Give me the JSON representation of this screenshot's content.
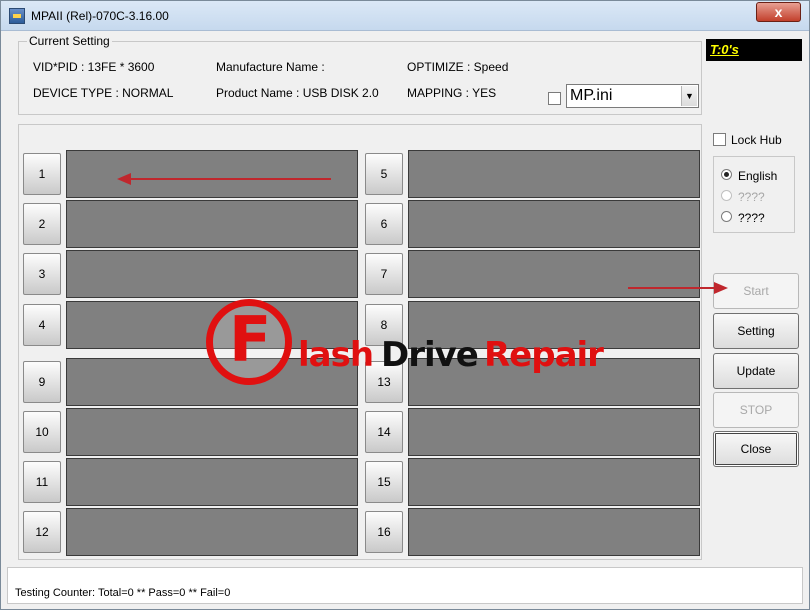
{
  "window": {
    "title": "MPAII (Rel)-070C-3.16.00",
    "close_glyph": "x"
  },
  "current_setting": {
    "legend": "Current Setting",
    "vid_pid": "VID*PID : 13FE * 3600",
    "manufacture_name": "Manufacture Name :",
    "optimize": "OPTIMIZE : Speed",
    "device_type": "DEVICE TYPE : NORMAL",
    "product_name": "Product Name : USB DISK 2.0",
    "mapping": "MAPPING : YES",
    "ini_file": "MP.ini"
  },
  "timer": "T:0's",
  "ports": {
    "left": [
      {
        "label": "1"
      },
      {
        "label": "2"
      },
      {
        "label": "3"
      },
      {
        "label": "4"
      },
      {
        "label": "9"
      },
      {
        "label": "10"
      },
      {
        "label": "11"
      },
      {
        "label": "12"
      }
    ],
    "right": [
      {
        "label": "5"
      },
      {
        "label": "6"
      },
      {
        "label": "7"
      },
      {
        "label": "8"
      },
      {
        "label": "13"
      },
      {
        "label": "14"
      },
      {
        "label": "15"
      },
      {
        "label": "16"
      }
    ]
  },
  "sidebar": {
    "lock_hub": "Lock Hub",
    "languages": [
      {
        "label": "English",
        "selected": true,
        "enabled": true
      },
      {
        "label": "????",
        "selected": false,
        "enabled": false
      },
      {
        "label": "????",
        "selected": false,
        "enabled": true
      }
    ],
    "buttons": {
      "start": "Start",
      "setting": "Setting",
      "update": "Update",
      "stop": "STOP",
      "close": "Close"
    }
  },
  "status": {
    "testing_counter": "Testing Counter: Total=0 ** Pass=0 ** Fail=0"
  },
  "watermark": {
    "letter": "F",
    "part1": "lash",
    "part2": "Drive",
    "part3": "Repair"
  },
  "colors": {
    "port_bar": "#808080",
    "timer_text": "#ffff00",
    "watermark_red": "#e01010",
    "arrow": "#c0272d"
  }
}
